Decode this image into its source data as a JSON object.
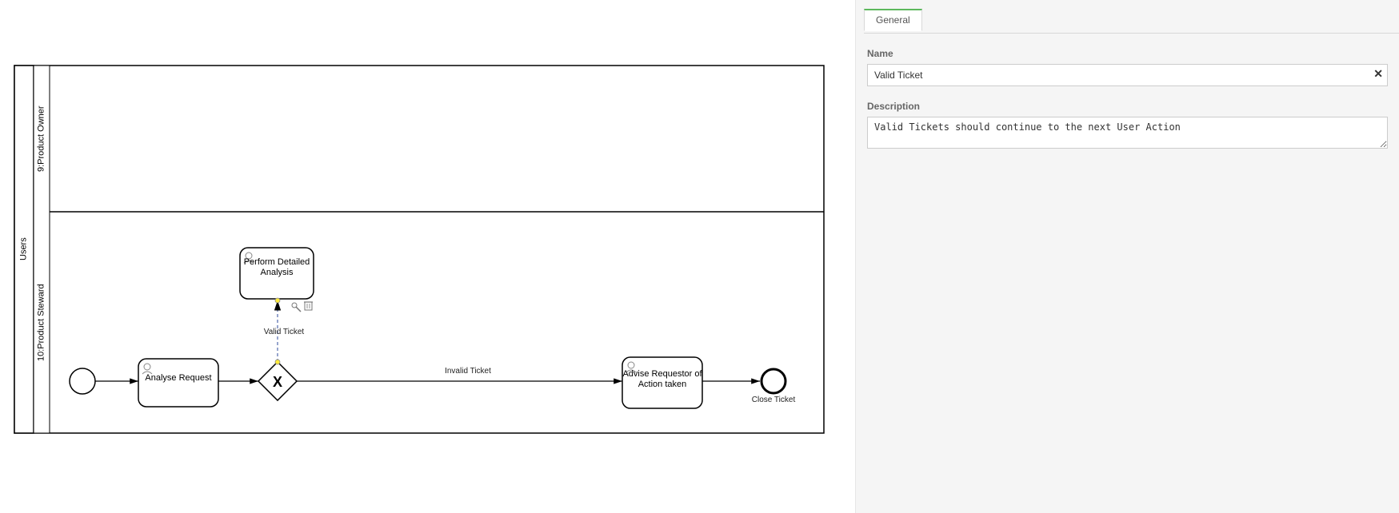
{
  "diagram": {
    "pool": {
      "label": "Users"
    },
    "lanes": {
      "top": {
        "label": "9:Product Owner"
      },
      "bottom": {
        "label": "10:Product Steward"
      }
    },
    "tasks": {
      "analyse": {
        "label": "Analyse Request"
      },
      "perform": {
        "label": "Perform Detailed Analysis"
      },
      "advise": {
        "label": "Advise Requestor of Action taken"
      }
    },
    "gateway": {
      "type": "exclusive"
    },
    "flows": {
      "valid": {
        "label": "Valid Ticket"
      },
      "invalid": {
        "label": "Invalid Ticket"
      }
    },
    "endEvent": {
      "label": "Close Ticket"
    }
  },
  "panel": {
    "tabs": {
      "general": "General"
    },
    "name": {
      "label": "Name",
      "value": "Valid Ticket"
    },
    "description": {
      "label": "Description",
      "value": "Valid Tickets should continue to the next User Action"
    }
  }
}
